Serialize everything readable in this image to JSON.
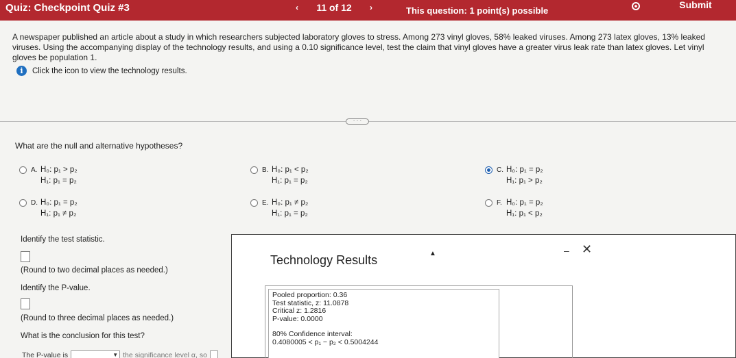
{
  "topbar": {
    "quiz_title": "Quiz: Checkpoint Quiz #3",
    "prev_label": "‹",
    "question_count": "11 of 12",
    "next_label": "›",
    "points": "This question: 1 point(s) possible",
    "submit_label": "Submit",
    "bar_color": "#b3282f"
  },
  "question": {
    "text": "A newspaper published an article about a study in which researchers subjected laboratory gloves to stress. Among 273 vinyl gloves, 58% leaked viruses. Among 273 latex gloves, 13% leaked viruses. Using the accompanying display of the technology results, and using a 0.10 significance level, test the claim that vinyl gloves have a greater virus leak rate than latex gloves. Let vinyl gloves be population 1.",
    "info_text": "Click the icon to view the technology results.",
    "more_label": "· · ·"
  },
  "hypotheses": {
    "prompt": "What are the null and alternative hypotheses?",
    "selected": "C",
    "options": [
      {
        "letter": "A.",
        "h0": "H₀: p₁ > p₂",
        "h1": "H₁: p₁ = p₂"
      },
      {
        "letter": "B.",
        "h0": "H₀: p₁ < p₂",
        "h1": "H₁: p₁ = p₂"
      },
      {
        "letter": "C.",
        "h0": "H₀: p₁ = p₂",
        "h1": "H₁: p₁ > p₂"
      },
      {
        "letter": "D.",
        "h0": "H₀: p₁ = p₂",
        "h1": "H₁: p₁ ≠ p₂"
      },
      {
        "letter": "E.",
        "h0": "H₀: p₁ ≠ p₂",
        "h1": "H₁: p₁ = p₂"
      },
      {
        "letter": "F.",
        "h0": "H₀: p₁ = p₂",
        "h1": "H₁: p₁ < p₂"
      }
    ]
  },
  "test_statistic": {
    "prompt": "Identify the test statistic.",
    "hint": "(Round to two decimal places as needed.)"
  },
  "p_value": {
    "prompt": "Identify the P-value.",
    "hint": "(Round to three decimal places as needed.)"
  },
  "conclusion": {
    "prompt": "What is the conclusion for this test?",
    "sentence_start": "The P-value is",
    "sentence_rest": "the significance level α, so"
  },
  "modal": {
    "title": "Technology Results",
    "minimize_label": "–",
    "close_label": "✕",
    "lines": {
      "pooled": "Pooled proportion: 0.36",
      "test_stat": "Test statistic, z: 11.0878",
      "critical": "Critical z: 1.2816",
      "pvalue": "P-value: 0.0000",
      "ci_label": "80% Confidence interval:",
      "ci_value": "0.4080005 < p₁ − p₂ < 0.5004244"
    }
  }
}
